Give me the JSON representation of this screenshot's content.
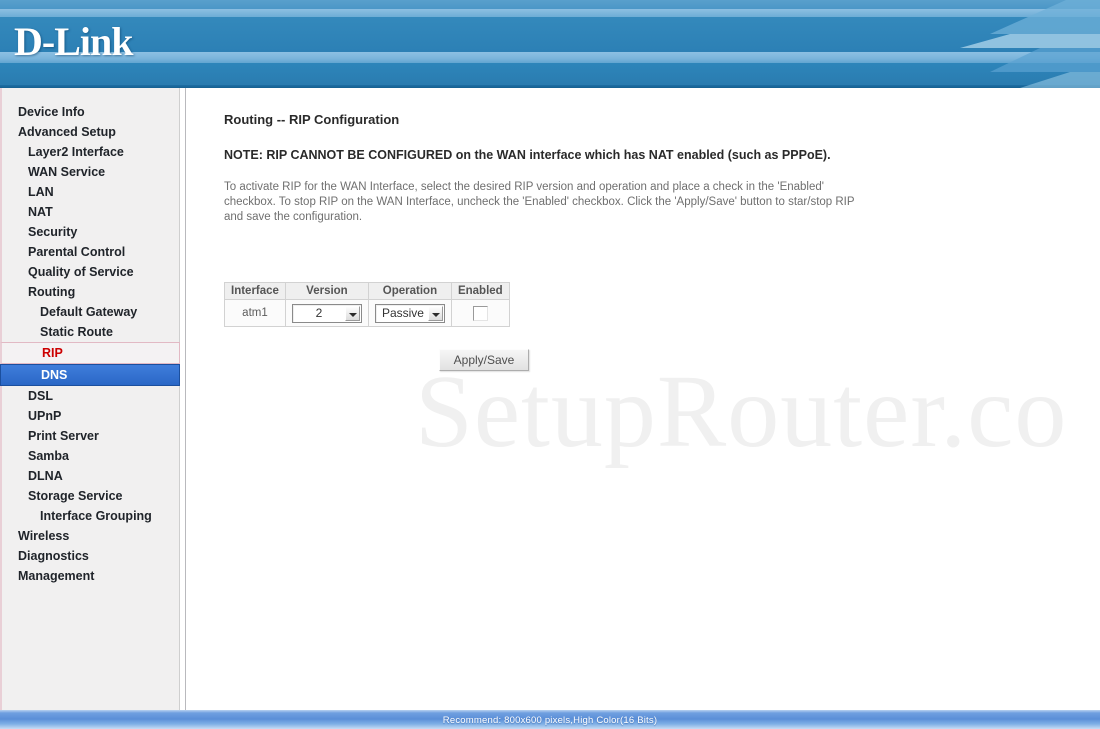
{
  "header": {
    "brand": "D-Link"
  },
  "sidebar": {
    "items": [
      {
        "label": "Device Info",
        "level": 1,
        "state": "normal"
      },
      {
        "label": "Advanced Setup",
        "level": 1,
        "state": "normal"
      },
      {
        "label": "Layer2 Interface",
        "level": 2,
        "state": "normal"
      },
      {
        "label": "WAN Service",
        "level": 2,
        "state": "normal"
      },
      {
        "label": "LAN",
        "level": 2,
        "state": "normal"
      },
      {
        "label": "NAT",
        "level": 2,
        "state": "normal"
      },
      {
        "label": "Security",
        "level": 2,
        "state": "normal"
      },
      {
        "label": "Parental Control",
        "level": 2,
        "state": "normal"
      },
      {
        "label": "Quality of Service",
        "level": 2,
        "state": "normal"
      },
      {
        "label": "Routing",
        "level": 2,
        "state": "normal"
      },
      {
        "label": "Default Gateway",
        "level": 3,
        "state": "normal"
      },
      {
        "label": "Static Route",
        "level": 3,
        "state": "normal"
      },
      {
        "label": "RIP",
        "level": 3,
        "state": "active"
      },
      {
        "label": "DNS",
        "level": 3,
        "state": "hover"
      },
      {
        "label": "DSL",
        "level": 2,
        "state": "normal"
      },
      {
        "label": "UPnP",
        "level": 2,
        "state": "normal"
      },
      {
        "label": "Print Server",
        "level": 2,
        "state": "normal"
      },
      {
        "label": "Samba",
        "level": 2,
        "state": "normal"
      },
      {
        "label": "DLNA",
        "level": 2,
        "state": "normal"
      },
      {
        "label": "Storage Service",
        "level": 2,
        "state": "normal"
      },
      {
        "label": "Interface Grouping",
        "level": 3,
        "state": "normal"
      },
      {
        "label": "Wireless",
        "level": 1,
        "state": "normal"
      },
      {
        "label": "Diagnostics",
        "level": 1,
        "state": "normal"
      },
      {
        "label": "Management",
        "level": 1,
        "state": "normal"
      }
    ]
  },
  "main": {
    "title": "Routing -- RIP Configuration",
    "note": "NOTE: RIP CANNOT BE CONFIGURED on the WAN interface which has NAT enabled (such as PPPoE).",
    "description": "To activate RIP for the WAN Interface, select the desired RIP version and operation and place a check in the 'Enabled' checkbox. To stop RIP on the WAN Interface, uncheck the 'Enabled' checkbox. Click the 'Apply/Save' button to star/stop RIP and save the configuration.",
    "table": {
      "headers": [
        "Interface",
        "Version",
        "Operation",
        "Enabled"
      ],
      "rows": [
        {
          "interface": "atm1",
          "version": "2",
          "operation": "Passive",
          "enabled": false
        }
      ]
    },
    "apply_button": "Apply/Save",
    "watermark": "SetupRouter.co"
  },
  "footer": {
    "text": "Recommend: 800x600 pixels,High Color(16 Bits)"
  }
}
